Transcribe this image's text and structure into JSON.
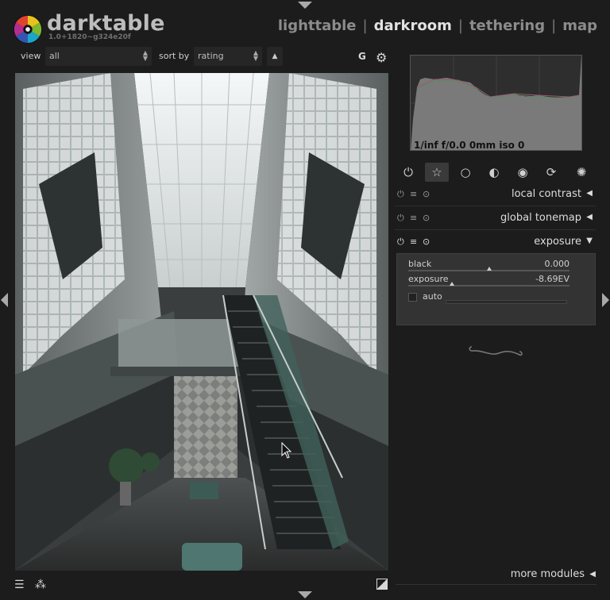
{
  "app": {
    "name": "darktable",
    "version": "1.0+1820~g324e20f"
  },
  "views": {
    "items": [
      "lighttable",
      "darkroom",
      "tethering",
      "map"
    ],
    "active": "darkroom",
    "separator": "|"
  },
  "toolbar": {
    "view_label": "view",
    "view_value": "all",
    "sort_label": "sort by",
    "sort_value": "rating",
    "sort_dir_icon": "triangle-up-icon",
    "grouping_label": "G",
    "settings_icon": "gear-icon"
  },
  "histogram": {
    "info": "1/inf f/0.0 0mm iso 0"
  },
  "module_groups": [
    {
      "icon": "power-icon",
      "glyph": "⏻"
    },
    {
      "icon": "star-icon",
      "glyph": "☆",
      "selected": true
    },
    {
      "icon": "circle-icon",
      "glyph": "○"
    },
    {
      "icon": "tone-circle-icon",
      "glyph": "◐"
    },
    {
      "icon": "color-circle-icon",
      "glyph": "◉"
    },
    {
      "icon": "correct-icon",
      "glyph": "⟳"
    },
    {
      "icon": "effect-icon",
      "glyph": "✺"
    }
  ],
  "modules": [
    {
      "name": "local contrast",
      "expanded": false
    },
    {
      "name": "global tonemap",
      "expanded": false
    },
    {
      "name": "exposure",
      "expanded": true
    }
  ],
  "exposure": {
    "black": {
      "label": "black",
      "value": "0.000",
      "level": 0.5
    },
    "exposure": {
      "label": "exposure",
      "value": "-8.69EV",
      "level": 0.27
    },
    "auto_label": "auto",
    "auto_checked": false
  },
  "more_modules": "more modules",
  "colors": {
    "background": "#1c1c1c",
    "panel": "#333333",
    "text": "#cfcfcf"
  }
}
